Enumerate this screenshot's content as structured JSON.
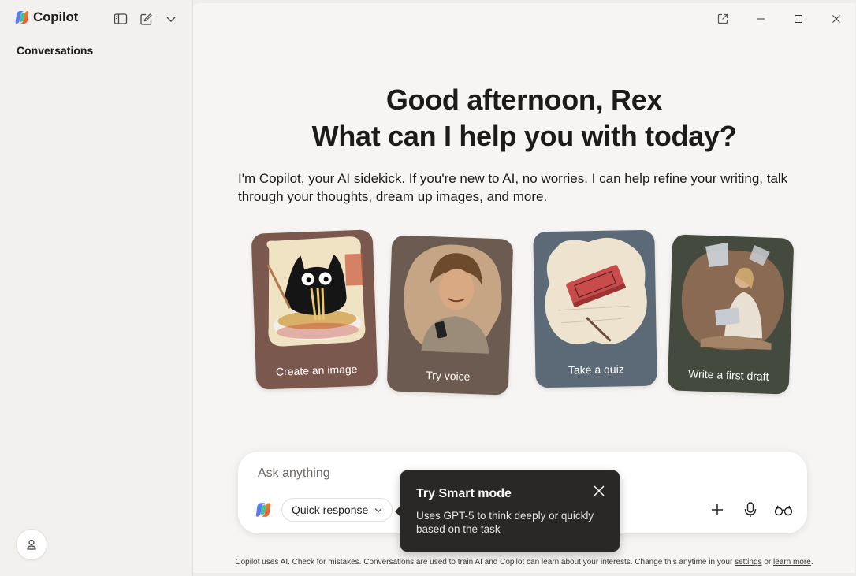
{
  "app": {
    "name": "Copilot"
  },
  "sidebar": {
    "conversations_title": "Conversations"
  },
  "main": {
    "greeting_line1": "Good afternoon, Rex",
    "greeting_line2": "What can I help you with today?",
    "intro": "I'm Copilot, your AI sidekick. If you're new to AI, no worries. I can help refine your writing, talk through your thoughts, dream up images, and more.",
    "cards": [
      {
        "label": "Create an image",
        "color": "#7b584e"
      },
      {
        "label": "Try voice",
        "color": "#6b5b50"
      },
      {
        "label": "Take a quiz",
        "color": "#5b6a76"
      },
      {
        "label": "Write a first draft",
        "color": "#454a3e"
      }
    ]
  },
  "composer": {
    "placeholder": "Ask anything",
    "mode_label": "Quick response",
    "icons": [
      "plus-icon",
      "microphone-icon",
      "glasses-icon"
    ]
  },
  "tooltip": {
    "title": "Try Smart mode",
    "body": "Uses GPT-5 to think deeply or quickly based on the task"
  },
  "footer": {
    "text": "Copilot uses AI. Check for mistakes. Conversations are used to train AI and Copilot can learn about your interests. Change this anytime in your",
    "settings_link": "settings",
    "or": "or",
    "learn_more_link": "learn more",
    "period": "."
  },
  "colors": {
    "accent": "#1c1b1a",
    "tooltip_bg": "#2a2826",
    "main_bg": "#f7f5f3"
  }
}
